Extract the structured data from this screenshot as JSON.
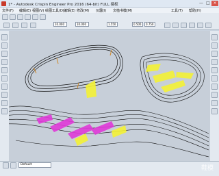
{
  "window": {
    "title": "1* - Autodesk Crispin Engineer Pro 2016 (64-bit)  FULL 授权",
    "controls": [
      "—",
      "□",
      "×"
    ]
  },
  "menu": {
    "items": [
      "文件(F)",
      "编辑(E)",
      "视图(V)",
      "绘图工具(D)",
      "编辑(E)",
      "修改(M)",
      "仪器(I)",
      "文植书模(M)",
      "工具(T)",
      "帮助(H)"
    ]
  },
  "toolbar": {
    "fields": [
      "10.000",
      "10.000",
      "1.550",
      "0.500",
      "0.750"
    ]
  },
  "status": {
    "layer_value": "Default"
  },
  "watermark": {
    "text": "鞋模"
  },
  "colors": {
    "magenta": "#e03ad8",
    "yellow": "#f4f235",
    "outline": "#111111",
    "canvas": "#c7cfd9"
  }
}
